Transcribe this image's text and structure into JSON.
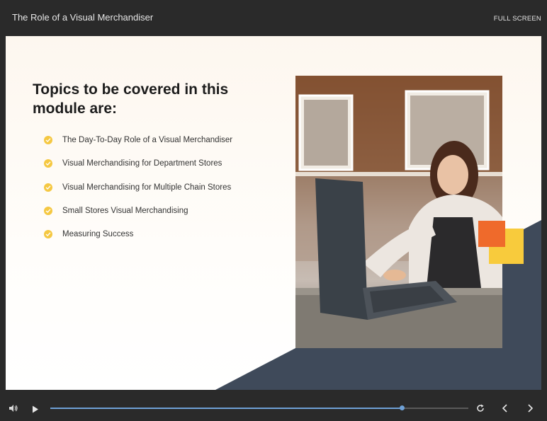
{
  "header": {
    "title": "The Role of a Visual Merchandiser",
    "fullscreen_label": "FULL SCREEN"
  },
  "slide": {
    "heading": "Topics to be covered in this module are:",
    "topics": [
      "The Day-To-Day Role of a Visual Merchandiser",
      "Visual Merchandising for Department Stores",
      "Visual Merchandising for Multiple Chain Stores",
      "Small Stores Visual Merchandising",
      "Measuring Success"
    ],
    "photo_description": "Woman working on laptop in cafe",
    "accent_colors": {
      "bullet": "#f5c842",
      "orange": "#ef6a2b",
      "yellow": "#f8cb3c",
      "navy": "#3f4a5a"
    }
  },
  "player": {
    "icons": [
      "volume-icon",
      "play-icon",
      "replay-icon",
      "previous-icon",
      "next-icon"
    ],
    "progress": 0.84
  }
}
